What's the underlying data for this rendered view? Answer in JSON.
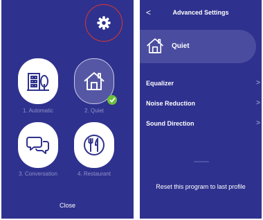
{
  "left_screen": {
    "programs": [
      {
        "label": "1. Automatic",
        "icon": "building-tree-icon",
        "selected": false
      },
      {
        "label": "2. Quiet",
        "icon": "house-icon",
        "selected": true
      },
      {
        "label": "3. Conversation",
        "icon": "chat-bubbles-icon",
        "selected": false
      },
      {
        "label": "4. Restaurant",
        "icon": "fork-knife-icon",
        "selected": false
      }
    ],
    "close_label": "Close"
  },
  "right_screen": {
    "title": "Advanced Settings",
    "back_glyph": "<",
    "current_program": "Quiet",
    "menu_items": [
      {
        "label": "Equalizer",
        "chevron": ">"
      },
      {
        "label": "Noise Reduction",
        "chevron": ">"
      },
      {
        "label": "Sound Direction",
        "chevron": ">"
      }
    ],
    "reset_label": "Reset this program to last profile"
  },
  "colors": {
    "background": "#2f318e",
    "pill": "#4a4c9f",
    "check": "#6cbf3b",
    "highlight_circle": "#d9392e"
  }
}
